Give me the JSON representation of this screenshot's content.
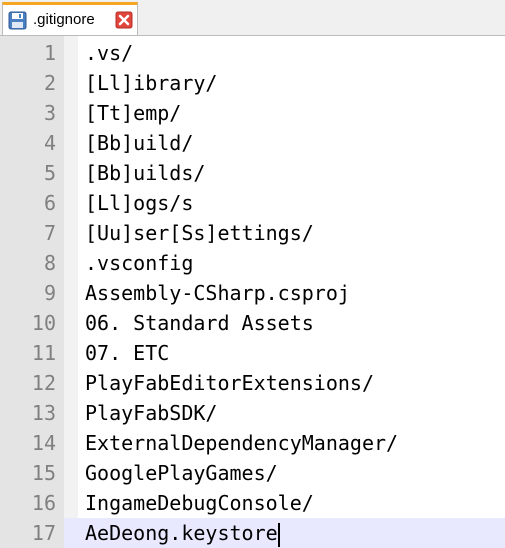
{
  "tab": {
    "label": ".gitignore",
    "save_icon": "floppy-disk-icon",
    "close_icon": "close-icon",
    "accent": "#f5a623",
    "close_color": "#e0463c"
  },
  "editor": {
    "current_line": 17,
    "lines": [
      {
        "num": "1",
        "text": ".vs/"
      },
      {
        "num": "2",
        "text": "[Ll]ibrary/"
      },
      {
        "num": "3",
        "text": "[Tt]emp/"
      },
      {
        "num": "4",
        "text": "[Bb]uild/"
      },
      {
        "num": "5",
        "text": "[Bb]uilds/"
      },
      {
        "num": "6",
        "text": "[Ll]ogs/s"
      },
      {
        "num": "7",
        "text": "[Uu]ser[Ss]ettings/"
      },
      {
        "num": "8",
        "text": ".vsconfig"
      },
      {
        "num": "9",
        "text": "Assembly-CSharp.csproj"
      },
      {
        "num": "10",
        "text": "06. Standard Assets"
      },
      {
        "num": "11",
        "text": "07. ETC"
      },
      {
        "num": "12",
        "text": "PlayFabEditorExtensions/"
      },
      {
        "num": "13",
        "text": "PlayFabSDK/"
      },
      {
        "num": "14",
        "text": "ExternalDependencyManager/"
      },
      {
        "num": "15",
        "text": "GooglePlayGames/"
      },
      {
        "num": "16",
        "text": "IngameDebugConsole/"
      },
      {
        "num": "17",
        "text": "AeDeong.keystore"
      }
    ]
  }
}
